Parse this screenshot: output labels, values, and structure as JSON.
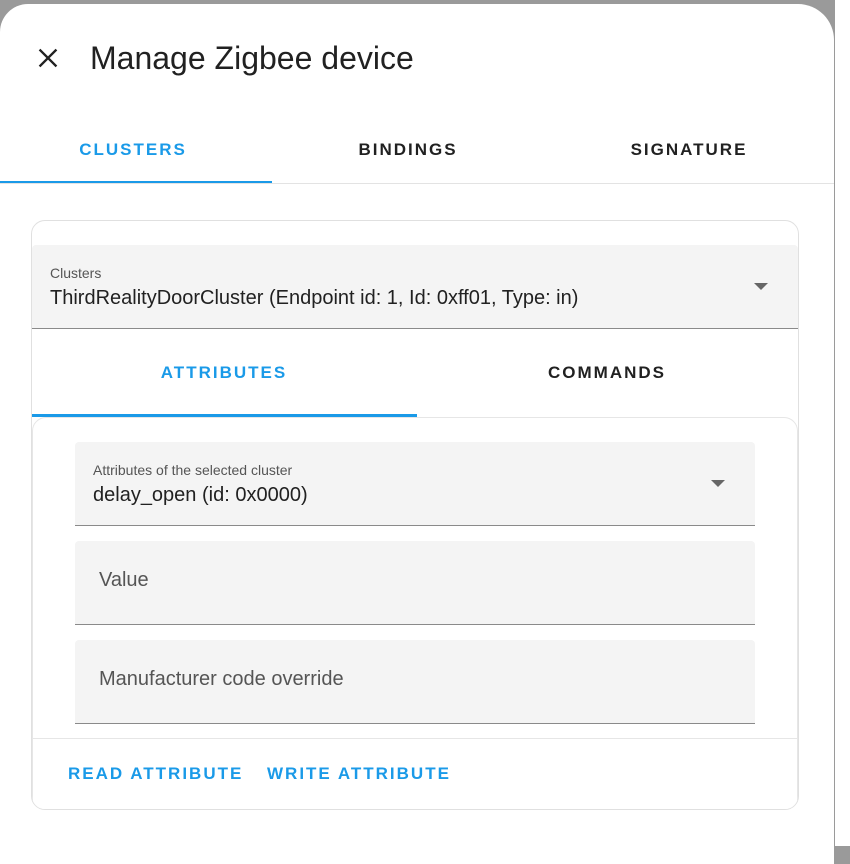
{
  "dialog": {
    "title": "Manage Zigbee device",
    "close_icon": "close-icon"
  },
  "main_tabs": [
    {
      "label": "CLUSTERS",
      "active": true
    },
    {
      "label": "BINDINGS",
      "active": false
    },
    {
      "label": "SIGNATURE",
      "active": false
    }
  ],
  "clusters_select": {
    "label": "Clusters",
    "value": "ThirdRealityDoorCluster (Endpoint id: 1, Id: 0xff01, Type: in)"
  },
  "sub_tabs": [
    {
      "label": "ATTRIBUTES",
      "active": true
    },
    {
      "label": "COMMANDS",
      "active": false
    }
  ],
  "attributes_select": {
    "label": "Attributes of the selected cluster",
    "value": "delay_open (id: 0x0000)"
  },
  "value_field": {
    "placeholder": "Value"
  },
  "manufacturer_field": {
    "placeholder": "Manufacturer code override"
  },
  "actions": {
    "read": "READ ATTRIBUTE",
    "write": "WRITE ATTRIBUTE"
  },
  "colors": {
    "accent": "#1a9ae8",
    "field_bg": "#f4f4f4",
    "text": "#212121"
  }
}
